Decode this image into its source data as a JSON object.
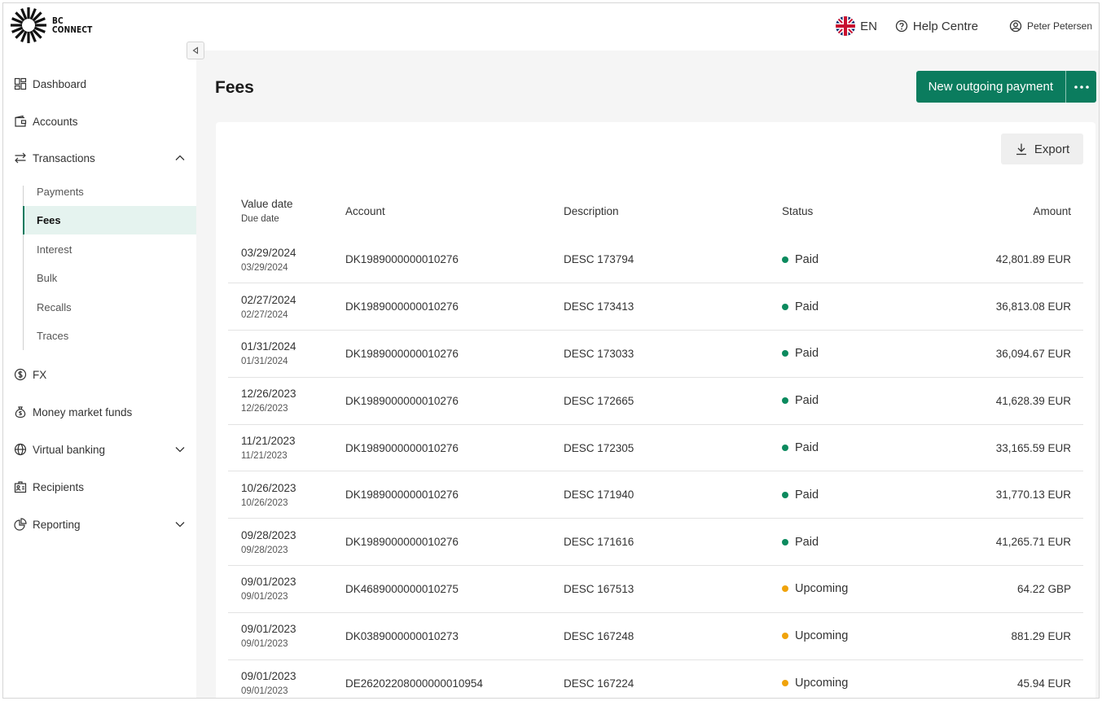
{
  "brand": {
    "line1": "BC",
    "line2": "CONNECT"
  },
  "topbar": {
    "language": "EN",
    "help": "Help Centre",
    "user": "Peter Petersen"
  },
  "sidebar": {
    "items": [
      {
        "label": "Dashboard",
        "icon": "dashboard-icon"
      },
      {
        "label": "Accounts",
        "icon": "wallet-icon"
      },
      {
        "label": "Transactions",
        "icon": "arrows-swap-icon",
        "expanded": true
      },
      {
        "label": "FX",
        "icon": "dollar-circle-icon"
      },
      {
        "label": "Money market funds",
        "icon": "money-bag-icon"
      },
      {
        "label": "Virtual banking",
        "icon": "globe-icon"
      },
      {
        "label": "Recipients",
        "icon": "contacts-icon"
      },
      {
        "label": "Reporting",
        "icon": "pie-chart-icon"
      }
    ],
    "transactions_sub": [
      {
        "label": "Payments"
      },
      {
        "label": "Fees",
        "active": true
      },
      {
        "label": "Interest"
      },
      {
        "label": "Bulk"
      },
      {
        "label": "Recalls"
      },
      {
        "label": "Traces"
      }
    ]
  },
  "main": {
    "title": "Fees",
    "new_payment_label": "New outgoing payment",
    "export_label": "Export",
    "status_colors": {
      "Paid": "#0b8a5e",
      "Upcoming": "#f0a30a"
    },
    "table": {
      "headers": {
        "value_date": "Value date",
        "due_date": "Due date",
        "account": "Account",
        "description": "Description",
        "status": "Status",
        "amount": "Amount"
      },
      "rows": [
        {
          "value_date": "03/29/2024",
          "due_date": "03/29/2024",
          "account": "DK1989000000010276",
          "description": "DESC 173794",
          "status": "Paid",
          "amount": "42,801.89 EUR"
        },
        {
          "value_date": "02/27/2024",
          "due_date": "02/27/2024",
          "account": "DK1989000000010276",
          "description": "DESC 173413",
          "status": "Paid",
          "amount": "36,813.08 EUR"
        },
        {
          "value_date": "01/31/2024",
          "due_date": "01/31/2024",
          "account": "DK1989000000010276",
          "description": "DESC 173033",
          "status": "Paid",
          "amount": "36,094.67 EUR"
        },
        {
          "value_date": "12/26/2023",
          "due_date": "12/26/2023",
          "account": "DK1989000000010276",
          "description": "DESC 172665",
          "status": "Paid",
          "amount": "41,628.39 EUR"
        },
        {
          "value_date": "11/21/2023",
          "due_date": "11/21/2023",
          "account": "DK1989000000010276",
          "description": "DESC 172305",
          "status": "Paid",
          "amount": "33,165.59 EUR"
        },
        {
          "value_date": "10/26/2023",
          "due_date": "10/26/2023",
          "account": "DK1989000000010276",
          "description": "DESC 171940",
          "status": "Paid",
          "amount": "31,770.13 EUR"
        },
        {
          "value_date": "09/28/2023",
          "due_date": "09/28/2023",
          "account": "DK1989000000010276",
          "description": "DESC 171616",
          "status": "Paid",
          "amount": "41,265.71 EUR"
        },
        {
          "value_date": "09/01/2023",
          "due_date": "09/01/2023",
          "account": "DK4689000000010275",
          "description": "DESC 167513",
          "status": "Upcoming",
          "amount": "64.22 GBP"
        },
        {
          "value_date": "09/01/2023",
          "due_date": "09/01/2023",
          "account": "DK0389000000010273",
          "description": "DESC 167248",
          "status": "Upcoming",
          "amount": "881.29 EUR"
        },
        {
          "value_date": "09/01/2023",
          "due_date": "09/01/2023",
          "account": "DE26202208000000010954",
          "description": "DESC 167224",
          "status": "Upcoming",
          "amount": "45.94 EUR"
        }
      ]
    }
  }
}
